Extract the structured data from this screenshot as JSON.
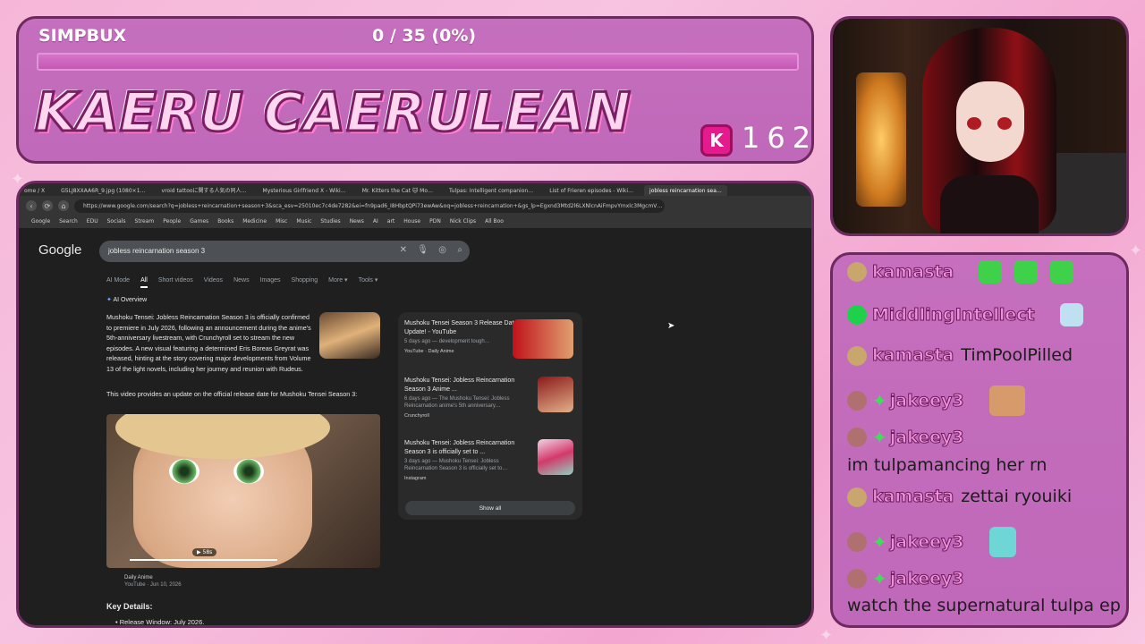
{
  "header": {
    "currency_label": "SIMPBUX",
    "progress_text": "0 / 35 (0%)",
    "progress_fraction": 0,
    "streamer_name": "KAERU CAERULEAN",
    "coin_glyph": "K",
    "coin_count": "162"
  },
  "browser": {
    "tabs": [
      "ome / X",
      "G5LJ8XXAA6R_9.jpg (1080×1…",
      "vroid tattooに関する人気の同人…",
      "Mysterious Girlfriend X - Wiki…",
      "Mr. Kitters the Cat 🐱 Mo…",
      "Tulpas: Intelligent companion…",
      "List of Frieren episodes - Wiki…",
      "jobless reincarnation sea…"
    ],
    "active_tab": 7,
    "url": "https://www.google.com/search?q=jobless+reincarnation+season+3&sca_esv=25010ec7c4de7282&ei=fn9pad6_I8HbptQPi73ewAw&oq=jobless+reincarnation+&gs_lp=Egxnd3Mtd2l6LXNlcnAiFmpvYmxlc3MgcmV…",
    "bookmarks": [
      "Google",
      "Search",
      "EDU",
      "Socials",
      "Stream",
      "People",
      "Games",
      "Books",
      "Medicine",
      "Misc",
      "Music",
      "Studies",
      "News",
      "AI",
      "art",
      "House",
      "PDN",
      "Nick Clips",
      "All Boo"
    ],
    "google": {
      "logo": "Google",
      "query": "jobless reincarnation season 3",
      "filters": [
        "AI Mode",
        "All",
        "Short videos",
        "Videos",
        "News",
        "Images",
        "Shopping",
        "More ▾",
        "Tools ▾"
      ],
      "active_filter": 1,
      "ai_overview_title": "AI Overview",
      "ai_text": "Mushoku Tensei: Jobless Reincarnation Season 3 is officially confirmed to premiere in July 2026, following an announcement during the anime's 5th-anniversary livestream, with Crunchyroll set to stream the new episodes. A new visual featuring a determined Eris Boreas Greyrat was released, hinting at the story covering major developments from Volume 13 of the light novels, including her journey and reunion with Rudeus.",
      "ai_text2": "This video provides an update on the official release date for Mushoku Tensei Season 3:",
      "video_duration": "▶ 58s",
      "video_source": "Daily Anime",
      "video_meta": "YouTube · Jun 10, 2026",
      "key_details": "Key Details:",
      "release_window": "• Release Window: July 2026.",
      "results": [
        {
          "title": "Mushoku Tensei Season 3 Release Date Update! - YouTube",
          "meta": "5 days ago — development tough…",
          "source": "YouTube · Daily Anime",
          "thumb_text": "1:42 SON 3"
        },
        {
          "title": "Mushoku Tensei: Jobless Reincarnation Season 3 Anime ...",
          "meta": "6 days ago — The Mushoku Tensei: Jobless Reincarnation anime's 5th anniversary…",
          "source": "Crunchyroll"
        },
        {
          "title": "Mushoku Tensei: Jobless Reincarnation Season 3 is officially set to ...",
          "meta": "3 days ago — Mushoku Tensei: Jobless Reincarnation Season 3 is officially set to…",
          "source": "Instagram"
        }
      ],
      "show_all": "Show all"
    }
  },
  "chat": [
    {
      "user": "kamasta",
      "text": "",
      "emotes": 3
    },
    {
      "user": "MiddlingIntellect",
      "text": "",
      "emotes": 1
    },
    {
      "user": "kamasta",
      "text": "TimPoolPilled",
      "emotes": 0
    },
    {
      "user": "jakeey3",
      "text": "",
      "emotes": 1
    },
    {
      "user": "jakeey3",
      "text": "im tulpamancing her rn",
      "emotes": 0
    },
    {
      "user": "kamasta",
      "text": "zettai ryouiki",
      "emotes": 0
    },
    {
      "user": "jakeey3",
      "text": "",
      "emotes": 1
    },
    {
      "user": "jakeey3",
      "text": "watch the supernatural tulpa ep",
      "emotes": 0
    }
  ],
  "colors": {
    "panel": "#c068b9",
    "border": "#6d2a60",
    "username": "#f090dc",
    "coin": "#e31b8c"
  }
}
